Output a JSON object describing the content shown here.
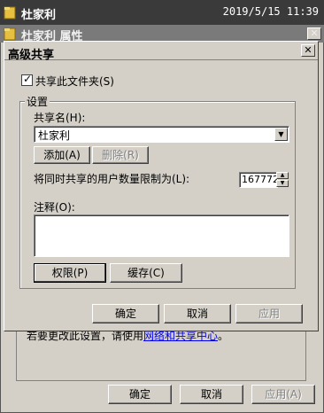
{
  "topbar": {
    "name": "杜家利",
    "time": "2019/5/15 11:39"
  },
  "bg_window": {
    "title": "杜家利 属性",
    "note_prefix": "若要更改此设置，请使用",
    "note_link": "网络和共享中心",
    "note_suffix": "。",
    "buttons": {
      "ok": "确定",
      "cancel": "取消",
      "apply": "应用(A)"
    }
  },
  "dialog": {
    "title": "高级共享",
    "share_checkbox": {
      "label": "共享此文件夹(S)",
      "checked": true
    },
    "settings_label": "设置",
    "share_name_label": "共享名(H):",
    "share_name_value": "杜家利",
    "add_button": "添加(A)",
    "remove_button": "删除(R)",
    "limit_label": "将同时共享的用户数量限制为(L):",
    "limit_value": "167772",
    "comment_label": "注释(O):",
    "comment_value": "",
    "permissions_button": "权限(P)",
    "caching_button": "缓存(C)",
    "buttons": {
      "ok": "确定",
      "cancel": "取消",
      "apply": "应用"
    }
  },
  "icons": {
    "folder": "folder-icon",
    "close": "close-icon"
  },
  "colors": {
    "face": "#d4d0c8",
    "link": "#0000ee",
    "topbar": "#3a3a3a"
  }
}
